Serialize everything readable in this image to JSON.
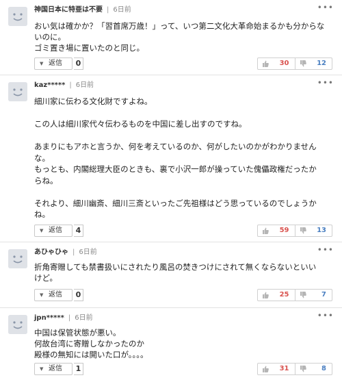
{
  "ui": {
    "reply_label": "返信",
    "more_label": "•••",
    "separator": "|",
    "colors": {
      "like": "#d9534f",
      "dislike": "#4a7fc1",
      "avatar_bg": "#dfe2e7"
    },
    "icons": {
      "reply_toggle": "triangle-down-icon",
      "like": "thumbs-up-icon",
      "dislike": "thumbs-down-icon",
      "avatar": "default-avatar-icon"
    }
  },
  "comments": [
    {
      "username": "神国日本に特亜は不要",
      "time": "6日前",
      "lines": [
        "おい気は確かか？「習首席万歳！」って、いつ第二文化大革命始まるかも分からな",
        "いのに。",
        "ゴミ置き場に置いたのと同じ。"
      ],
      "reply_count": "0",
      "likes": "30",
      "dislikes": "12"
    },
    {
      "username": "kaz*****",
      "time": "6日前",
      "lines": [
        "細川家に伝わる文化財ですよね。",
        "",
        "この人は細川家代々伝わるものを中国に差し出すのですね。",
        "",
        "あまりにもアホと言うか、何を考えているのか、何がしたいのかがわかりません",
        "な。",
        "もっとも、内閣総理大臣のときも、裏で小沢一郎が操っていた傀儡政権だったか",
        "らね。",
        "",
        "それより、細川幽斎、細川三斎といったご先祖様はどう思っているのでしょうか",
        "ね。"
      ],
      "reply_count": "4",
      "likes": "59",
      "dislikes": "13"
    },
    {
      "username": "あひゃひゃ",
      "time": "6日前",
      "lines": [
        "折角寄贈しても禁書扱いにされたり風呂の焚きつけにされて無くならないといい",
        "けど。"
      ],
      "reply_count": "0",
      "likes": "25",
      "dislikes": "7"
    },
    {
      "username": "jpn*****",
      "time": "6日前",
      "lines": [
        "中国は保管状態が悪い。",
        "何故台湾に寄贈しなかったのか",
        "殿様の無知には開いた口が。。。。"
      ],
      "reply_count": "1",
      "likes": "31",
      "dislikes": "8"
    }
  ]
}
